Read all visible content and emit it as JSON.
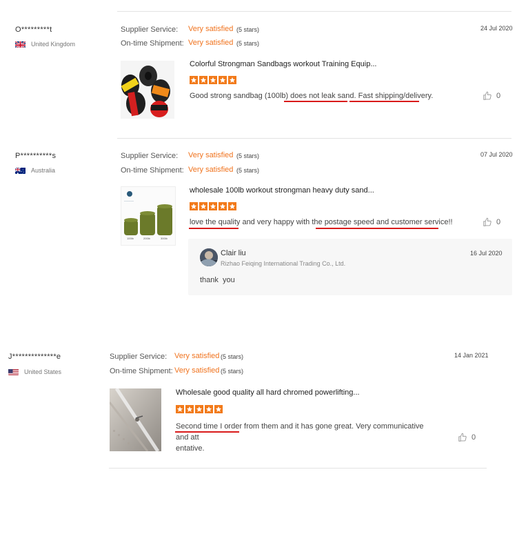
{
  "reviews": [
    {
      "user": "O*********t",
      "country": "United Kingdom",
      "date": "24 Jul 2020",
      "supplier_label": "Supplier Service:",
      "supplier_value": "Very satisfied",
      "supplier_stars": "(5 stars)",
      "shipment_label": "On-time Shipment:",
      "shipment_value": "Very satisfied",
      "shipment_stars": "(5 stars)",
      "product_title": "Colorful Strongman Sandbags workout Training Equip...",
      "review_segments": [
        "Good strong sandbag (100lb) ",
        "does not leak sand.",
        " ",
        "Fast shipping/delivery",
        "."
      ],
      "likes": "0",
      "rating": 5
    },
    {
      "user": "P**********s",
      "country": "Australia",
      "date": "07 Jul 2020",
      "supplier_label": "Supplier Service:",
      "supplier_value": "Very satisfied",
      "supplier_stars": "(5 stars)",
      "shipment_label": "On-time Shipment:",
      "shipment_value": "Very satisfied",
      "shipment_stars": "(5 stars)",
      "product_title": "wholesale 100lb workout strongman heavy duty sand...",
      "review_segments": [
        "love the quality",
        " and very happy with the ",
        "postage speed and customer service!!"
      ],
      "likes": "0",
      "rating": 5,
      "product_image_labels": [
        "100lb",
        "200lb",
        "300lb"
      ],
      "reply": {
        "name": "Clair liu",
        "company": "Rizhao Feiqing International Trading Co., Ltd.",
        "date": "16 Jul 2020",
        "text": "thank  you"
      }
    },
    {
      "user": "J**************e",
      "country": "United States",
      "date": "14 Jan 2021",
      "supplier_label": "Supplier Service:",
      "supplier_value": "Very satisfied",
      "supplier_stars": "(5 stars)",
      "shipment_label": "On-time Shipment:",
      "shipment_value": "Very satisfied",
      "shipment_stars": "(5 stars)",
      "product_title": "Wholesale good quality all hard chromed powerlifting...",
      "review_segments": [
        "Second time I order",
        " from them and it has gone great. Very communicative and att",
        "entative."
      ],
      "likes": "0",
      "rating": 5
    }
  ],
  "colors": {
    "accent": "#f27a1a",
    "underline": "#d91a1a",
    "divider": "#e3e3e3"
  },
  "icons": {
    "like": "thumbs-up-icon",
    "star": "star-icon",
    "avatar": "avatar"
  }
}
